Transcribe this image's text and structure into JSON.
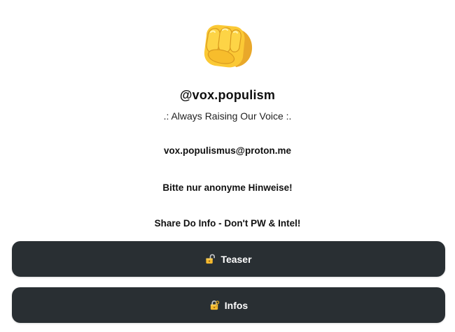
{
  "profile": {
    "avatar_icon": "oncoming-fist-emoji",
    "username": "@vox.populism",
    "tagline": ".: Always Raising Our Voice :."
  },
  "text_lines": {
    "email": "vox.populismus@proton.me",
    "note": "Bitte nur anonyme Hinweise!",
    "share": "Share Do Info - Don't PW & Intel!"
  },
  "links": [
    {
      "label": "Teaser",
      "icon": "unlocked-padlock-icon"
    },
    {
      "label": "Infos",
      "icon": "lock-with-key-icon"
    }
  ],
  "colors": {
    "button_bg": "#292f33",
    "button_text": "#ffffff",
    "page_bg": "#ffffff"
  }
}
